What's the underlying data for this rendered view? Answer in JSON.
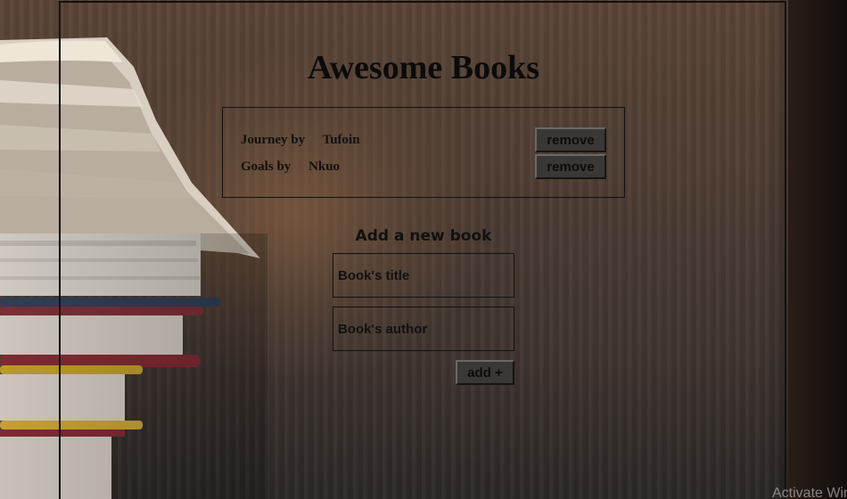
{
  "page": {
    "title": "Awesome Books"
  },
  "books": [
    {
      "title": "Journey",
      "by": "by",
      "author": "Tufoin",
      "remove_label": "remove"
    },
    {
      "title": "Goals",
      "by": "by",
      "author": "Nkuo",
      "remove_label": "remove"
    }
  ],
  "form": {
    "heading": "Add a new book",
    "title_placeholder": "Book's title",
    "author_placeholder": "Book's author",
    "add_label": "add +"
  },
  "watermark": "Activate Windows",
  "colors": {
    "button_bg": "#3a3836",
    "text": "#111111",
    "border": "#111111"
  }
}
